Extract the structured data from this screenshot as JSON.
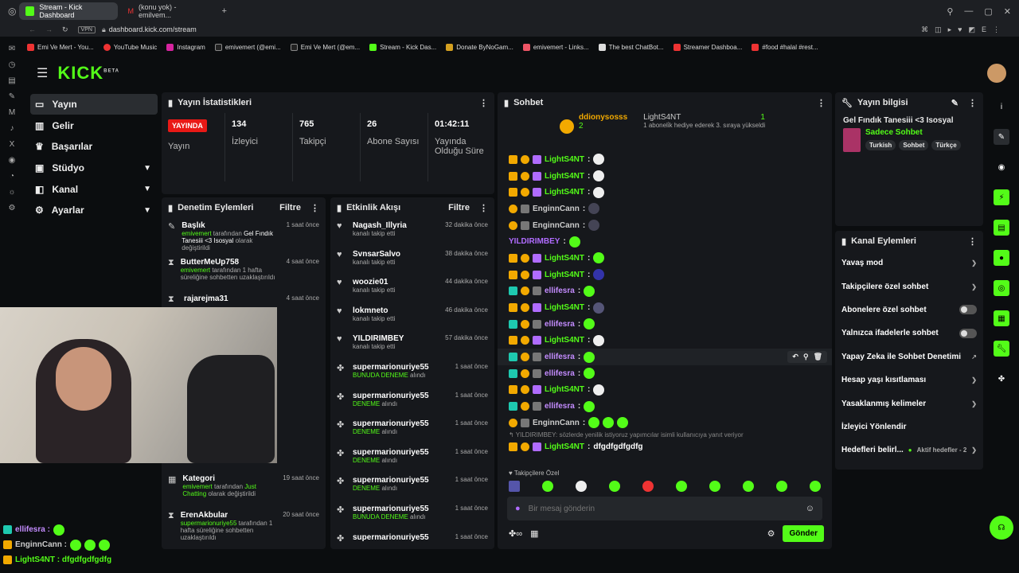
{
  "browser": {
    "tabs": [
      {
        "label": "Stream - Kick Dashboard",
        "active": true
      },
      {
        "label": "(konu yok) - emilvem...",
        "active": false
      }
    ],
    "url": "dashboard.kick.com/stream",
    "vpn": "VPN",
    "bookmarks": [
      "Emi Ve Mert - You...",
      "YouTube Music",
      "Instagram",
      "emivemert (@emi...",
      "Emi Ve Mert (@em...",
      "Stream - Kick Das...",
      "Donate ByNoGam...",
      "emivemert - Links...",
      "The best ChatBot...",
      "Streamer Dashboa...",
      "#food #halal #rest..."
    ]
  },
  "brand": {
    "logo": "KICK",
    "beta": "BETA",
    "accent": "#53fc18"
  },
  "sidebar": {
    "items": [
      {
        "label": "Yayın",
        "icon": "broadcast-icon"
      },
      {
        "label": "Gelir",
        "icon": "chart-icon"
      },
      {
        "label": "Başarılar",
        "icon": "trophy-icon"
      },
      {
        "label": "Stüdyo",
        "icon": "studio-icon",
        "chevron": true
      },
      {
        "label": "Kanal",
        "icon": "channel-icon",
        "chevron": true
      },
      {
        "label": "Ayarlar",
        "icon": "gear-icon",
        "chevron": true
      }
    ]
  },
  "stats": {
    "title": "Yayın İstatistikleri",
    "live": "YAYINDA",
    "items": [
      {
        "label": "Yayın",
        "value": ""
      },
      {
        "label": "İzleyici",
        "value": "134"
      },
      {
        "label": "Takipçi",
        "value": "765"
      },
      {
        "label": "Abone Sayısı",
        "value": "26"
      },
      {
        "label": "Yayında Olduğu Süre",
        "value": "01:42:11"
      }
    ]
  },
  "moderation": {
    "title": "Denetim Eylemleri",
    "filter": "Filtre",
    "rows": [
      {
        "name": "Başlık",
        "actor": "emivemert",
        "text": "tarafından",
        "extra": "Gel Fındık Tanesiii <3 Isosyal",
        "tail": "olarak değiştirildi",
        "time": "1 saat önce"
      },
      {
        "name": "ButterMeUp758",
        "actor": "emivemert",
        "text": "tarafından 1 hafta süreliğine sohbetten uzaklaştırıldı",
        "extra": "",
        "tail": "",
        "time": "4 saat önce"
      },
      {
        "name": "rajarejma31",
        "actor": "",
        "text": "",
        "extra": "",
        "tail": "",
        "time": "4 saat önce"
      },
      {
        "name": "Kategori",
        "actor": "emivemert",
        "text": "tarafından",
        "extra": "Just Chatting",
        "tail": "olarak değiştirildi",
        "time": "19 saat önce"
      },
      {
        "name": "ErenAkbular",
        "actor": "supermarionuriye55",
        "text": "tarafından 1 hafta süreliğine sohbetten uzaklaştırıldı",
        "extra": "",
        "tail": "",
        "time": "20 saat önce"
      }
    ]
  },
  "activity": {
    "title": "Etkinlik Akışı",
    "filter": "Filtre",
    "rows": [
      {
        "name": "Nagash_Illyria",
        "desc": "kanalı takip etti",
        "time": "32 dakika önce"
      },
      {
        "name": "SvnsarSalvo",
        "desc": "kanalı takip etti",
        "time": "38 dakika önce"
      },
      {
        "name": "woozie01",
        "desc": "kanalı takip etti",
        "time": "44 dakika önce"
      },
      {
        "name": "lokmneto",
        "desc": "kanalı takip etti",
        "time": "46 dakika önce"
      },
      {
        "name": "YILDIRIMBEY",
        "desc": "kanalı takip etti",
        "time": "57 dakika önce"
      },
      {
        "name": "supermarionuriye55",
        "reward": "BUNUDA DENEME",
        "desc": "alındı",
        "time": "1 saat önce"
      },
      {
        "name": "supermarionuriye55",
        "reward": "DENEME",
        "desc": "alındı",
        "time": "1 saat önce"
      },
      {
        "name": "supermarionuriye55",
        "reward": "DENEME",
        "desc": "alındı",
        "time": "1 saat önce"
      },
      {
        "name": "supermarionuriye55",
        "reward": "DENEME",
        "desc": "alındı",
        "time": "1 saat önce"
      },
      {
        "name": "supermarionuriye55",
        "reward": "DENEME",
        "desc": "alındı",
        "time": "1 saat önce"
      },
      {
        "name": "supermarionuriye55",
        "reward": "BUNUDA DENEME",
        "desc": "alındı",
        "time": "1 saat önce"
      },
      {
        "name": "supermarionuriye55",
        "reward": "",
        "desc": "",
        "time": "1 saat önce"
      }
    ]
  },
  "chat": {
    "title": "Sohbet",
    "pinned": {
      "gifter": "ddionysosss",
      "count": "2",
      "user": "LightS4NT",
      "gift": "1",
      "note": "1 aboneli̇k hediye ederek 3. sıraya yükseldi"
    },
    "messages": [
      {
        "user": "LightS4NT",
        "color": "#53fc18"
      },
      {
        "user": "LightS4NT",
        "color": "#53fc18"
      },
      {
        "user": "LightS4NT",
        "color": "#53fc18"
      },
      {
        "user": "EnginnCann",
        "color": "#cccccc"
      },
      {
        "user": "EnginnCann",
        "color": "#cccccc"
      },
      {
        "user": "YILDIRIMBEY",
        "color": "#b06cff"
      },
      {
        "user": "LightS4NT",
        "color": "#53fc18"
      },
      {
        "user": "LightS4NT",
        "color": "#53fc18"
      },
      {
        "user": "ellifesra",
        "color": "#c48cff"
      },
      {
        "user": "LightS4NT",
        "color": "#53fc18"
      },
      {
        "user": "ellifesra",
        "color": "#c48cff"
      },
      {
        "user": "LightS4NT",
        "color": "#53fc18"
      },
      {
        "user": "ellifesra",
        "color": "#c48cff"
      },
      {
        "user": "ellifesra",
        "color": "#c48cff"
      },
      {
        "user": "LightS4NT",
        "color": "#53fc18"
      },
      {
        "user": "ellifesra",
        "color": "#c48cff"
      },
      {
        "user": "EnginnCann",
        "color": "#cccccc"
      }
    ],
    "reply_note": "YILDIRIMBEY: sözlerde yenilik istiyoruz yapımcılar isimli kullanıcıya yanıt veriyor",
    "last": {
      "user": "LightS4NT",
      "text": "dfgdfgdfgdfg"
    },
    "followers_only": "Takipçilere Özel",
    "placeholder": "Bir mesaj gönderin",
    "send": "Gönder"
  },
  "info": {
    "title": "Yayın bilgisi",
    "stream_title": "Gel Fındık Tanesiii <3 Isosyal",
    "category": "Sadece Sohbet",
    "tags": [
      "Turkish",
      "Sohbet",
      "Türkçe"
    ]
  },
  "channel_actions": {
    "title": "Kanal Eylemleri",
    "items": [
      {
        "label": "Yavaş mod",
        "type": "chevron"
      },
      {
        "label": "Takipçilere özel sohbet",
        "type": "chevron"
      },
      {
        "label": "Abonelere özel sohbet",
        "type": "toggle"
      },
      {
        "label": "Yalnızca ifadelerle sohbet",
        "type": "toggle"
      },
      {
        "label": "Yapay Zeka ile Sohbet Denetimi",
        "type": "external"
      },
      {
        "label": "Hesap yaşı kısıtlaması",
        "type": "chevron"
      },
      {
        "label": "Yasaklanmış kelimeler",
        "type": "chevron"
      },
      {
        "label": "İzleyici Yönlendir",
        "type": "none"
      },
      {
        "label": "Hedefleri belirl...",
        "type": "goal",
        "extra": "Aktif hedefler - 2"
      }
    ]
  },
  "overlay": [
    {
      "user": "ellifesra :",
      "color": "#c48cff"
    },
    {
      "user": "EnginnCann :",
      "color": "#cccccc"
    },
    {
      "user": "LightS4NT : dfgdfgdfgdfg",
      "color": "#53fc18"
    }
  ]
}
